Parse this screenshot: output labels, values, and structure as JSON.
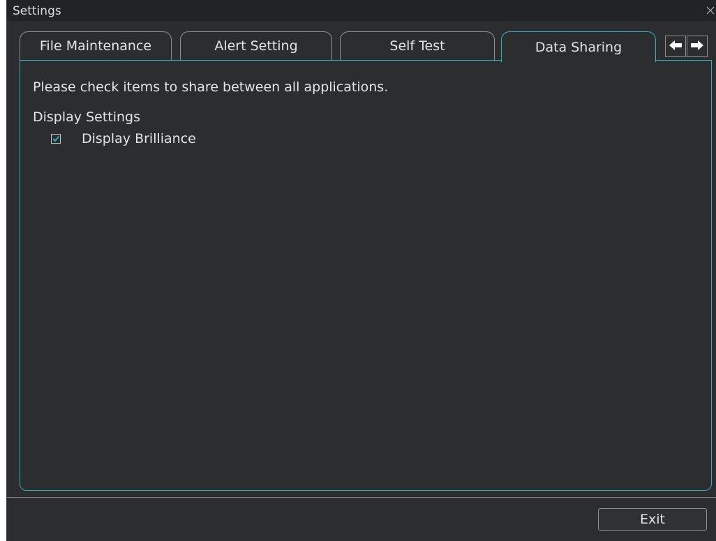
{
  "window": {
    "title": "Settings"
  },
  "tabs": [
    {
      "label": "File Maintenance",
      "active": false
    },
    {
      "label": "Alert Setting",
      "active": false
    },
    {
      "label": "Self Test",
      "active": false
    },
    {
      "label": "Data Sharing",
      "active": true
    }
  ],
  "tab_scroll": {
    "left_icon": "arrow-left-icon",
    "right_icon": "arrow-right-icon"
  },
  "panel": {
    "instruction": "Please check items to share between all applications.",
    "section_title": "Display Settings",
    "items": [
      {
        "label": "Display Brilliance",
        "checked": true
      }
    ]
  },
  "footer": {
    "exit_label": "Exit"
  },
  "colors": {
    "accent": "#2ab3c0",
    "background": "#2b2d2f",
    "titlebar": "#212325"
  }
}
